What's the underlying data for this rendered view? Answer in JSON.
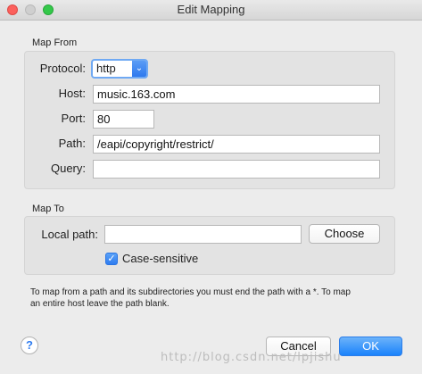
{
  "window": {
    "title": "Edit Mapping"
  },
  "map_from": {
    "section_label": "Map From",
    "protocol": {
      "label": "Protocol:",
      "value": "http"
    },
    "host": {
      "label": "Host:",
      "value": "music.163.com"
    },
    "port": {
      "label": "Port:",
      "value": "80"
    },
    "path": {
      "label": "Path:",
      "value": "/eapi/copyright/restrict/"
    },
    "query": {
      "label": "Query:",
      "value": ""
    }
  },
  "map_to": {
    "section_label": "Map To",
    "local_path": {
      "label": "Local path:",
      "value": ""
    },
    "choose_label": "Choose",
    "case_sensitive": {
      "label": "Case-sensitive",
      "checked": true
    }
  },
  "help_text_line1": "To map from a path and its subdirectories you must end the path with a *. To map",
  "help_text_line2": "an entire host leave the path blank.",
  "buttons": {
    "help": "?",
    "cancel": "Cancel",
    "ok": "OK"
  },
  "watermark": "http://blog.csdn.net/lpjishu",
  "colors": {
    "accent": "#2f7cf0",
    "close": "#fc605c",
    "maximize": "#34c84a"
  }
}
